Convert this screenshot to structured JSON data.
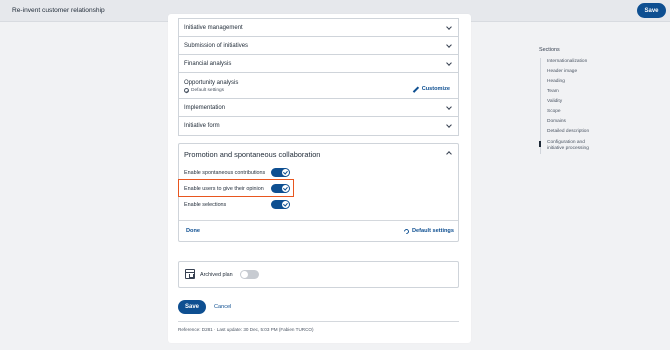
{
  "header": {
    "title": "Re-invent customer relationship",
    "save_label": "Save"
  },
  "accordions": [
    {
      "label": "Initiative management"
    },
    {
      "label": "Submission of initiatives"
    },
    {
      "label": "Financial analysis"
    },
    {
      "label": "Opportunity analysis",
      "sub": "Default settings",
      "action": "Customize"
    },
    {
      "label": "Implementation"
    },
    {
      "label": "Initiative form"
    }
  ],
  "promotion": {
    "title": "Promotion and spontaneous collaboration",
    "options": [
      {
        "label": "Enable spontaneous contributions",
        "enabled": true
      },
      {
        "label": "Enable users to give their opinion",
        "enabled": true
      },
      {
        "label": "Enable selections",
        "enabled": true
      }
    ],
    "done_label": "Done",
    "default_label": "Default settings"
  },
  "archived": {
    "label": "Archived plan",
    "enabled": false
  },
  "form_actions": {
    "save_label": "Save",
    "cancel_label": "Cancel"
  },
  "footer": {
    "reference": "Reference: D281  ·  Last update: 30 Dec, 5:03 PM (Fabien TURCO)"
  },
  "sections_nav": {
    "title": "Sections",
    "items": [
      "Internationalization",
      "Header image",
      "Heading",
      "Team",
      "Validity",
      "Scope",
      "Domains",
      "Detailed description",
      "Configuration and initiative processing"
    ],
    "active_index": 8
  },
  "colors": {
    "accent": "#0e4f91",
    "highlight": "#e8561f",
    "background": "#f1f2f4"
  }
}
